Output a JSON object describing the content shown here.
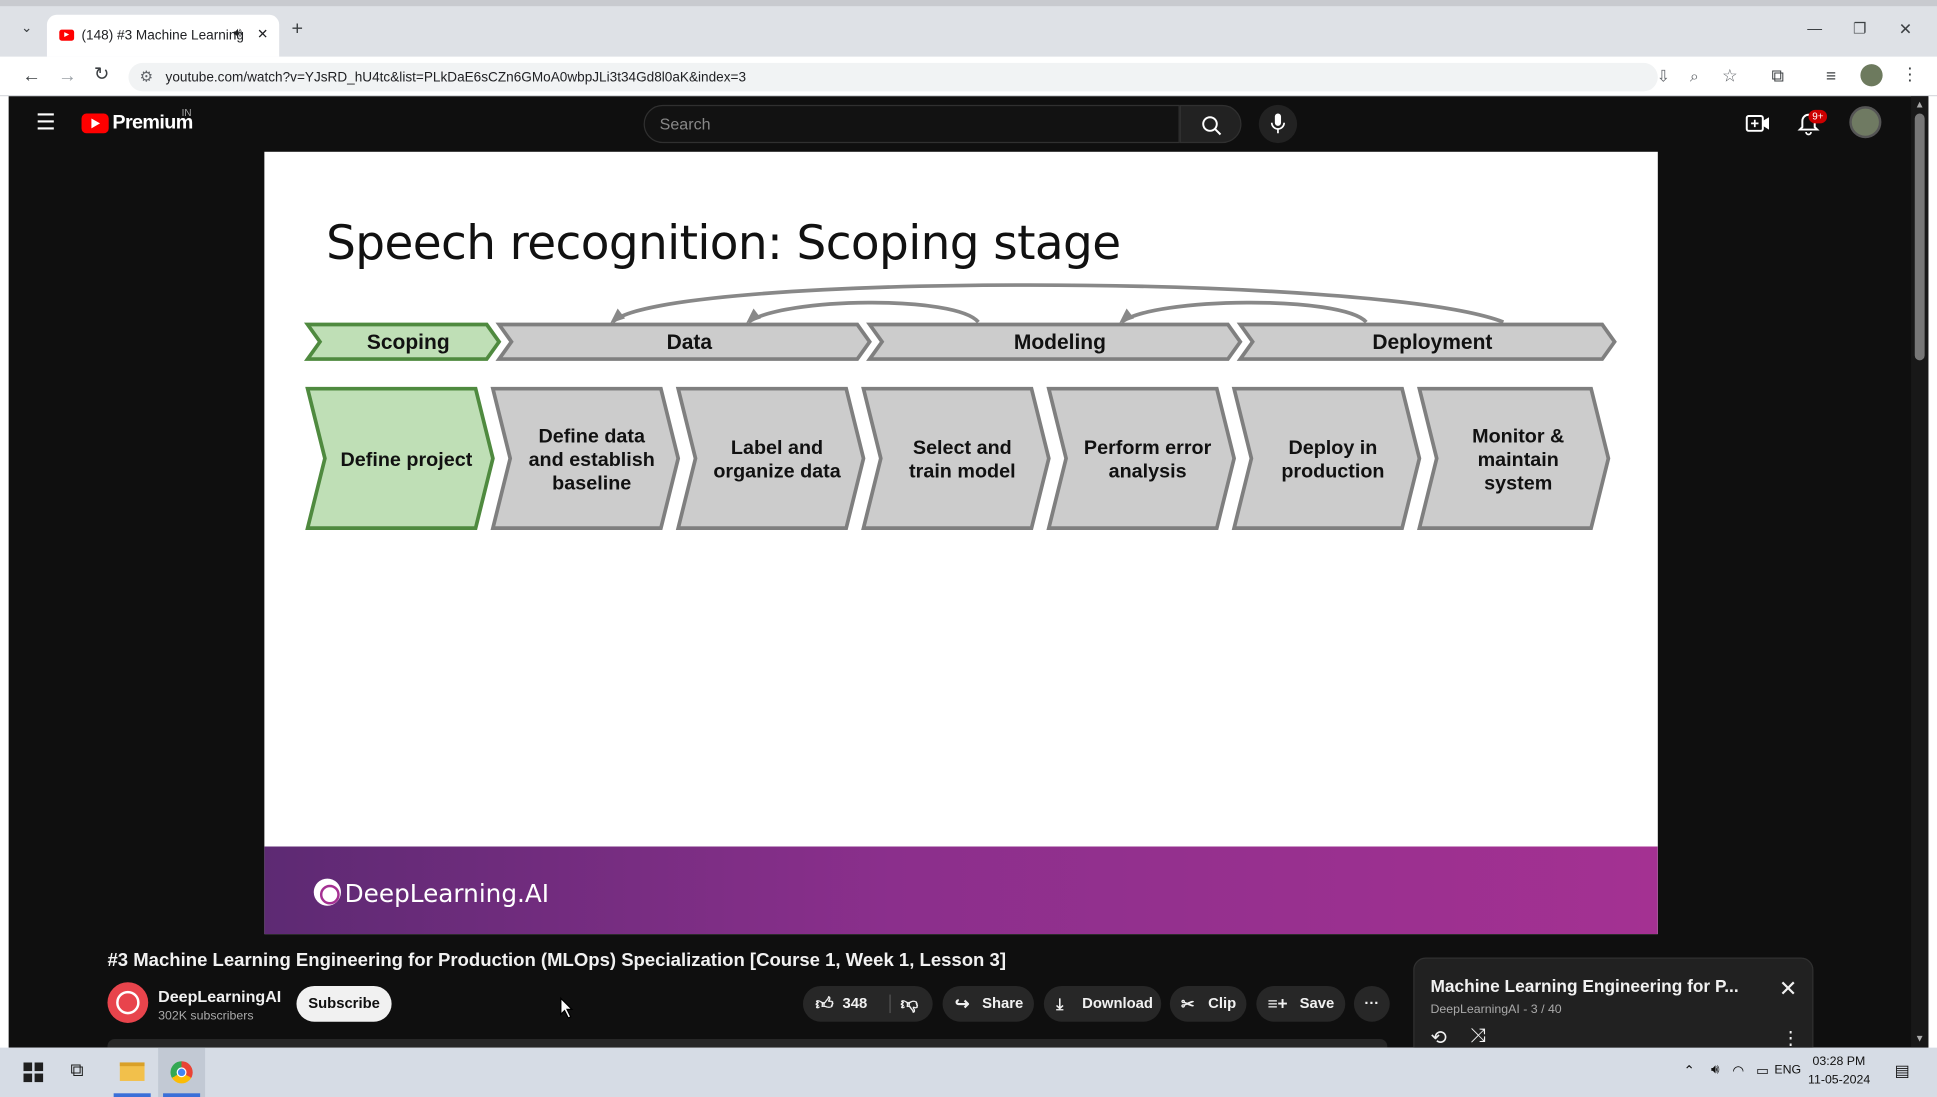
{
  "browser": {
    "tab_title": "(148) #3 Machine Learning",
    "tab_close": "✕",
    "new_tab": "+",
    "url": "youtube.com/watch?v=YJsRD_hU4tc&list=PLkDaE6sCZn6GMoA0wbpJLi3t34Gd8l0aK&index=3",
    "window_controls": {
      "minimize": "—",
      "restore": "❐",
      "close": "✕"
    }
  },
  "youtube": {
    "logo_text": "Premium",
    "region": "IN",
    "search_placeholder": "Search",
    "notification_count": "9+"
  },
  "slide": {
    "title": "Speech recognition: Scoping stage",
    "phases": [
      "Scoping",
      "Data",
      "Modeling",
      "Deployment"
    ],
    "steps": [
      [
        "Define project"
      ],
      [
        "Define data",
        "and establish",
        "baseline"
      ],
      [
        "Label and",
        "organize data"
      ],
      [
        "Select and",
        "train model"
      ],
      [
        "Perform error",
        "analysis"
      ],
      [
        "Deploy in",
        "production"
      ],
      [
        "Monitor &",
        "maintain",
        "system"
      ]
    ],
    "brand": "DeepLearning.AI",
    "colors": {
      "active_fill": "#bfdfb6",
      "active_stroke": "#4f8a3f",
      "inactive_fill": "#cccccc",
      "inactive_stroke": "#7f7f7f"
    }
  },
  "video": {
    "title": "#3 Machine Learning Engineering for Production (MLOps) Specialization [Course 1, Week 1, Lesson 3]",
    "channel": "DeepLearningAI",
    "subscribers": "302K subscribers",
    "subscribe_label": "Subscribe",
    "likes": "348",
    "share_label": "Share",
    "download_label": "Download",
    "clip_label": "Clip",
    "save_label": "Save",
    "more_label": "···"
  },
  "playlist": {
    "title": "Machine Learning Engineering for P...",
    "subtitle": "DeepLearningAI - 3 / 40"
  },
  "taskbar": {
    "language": "ENG",
    "time": "03:28 PM",
    "date": "11-05-2024"
  }
}
